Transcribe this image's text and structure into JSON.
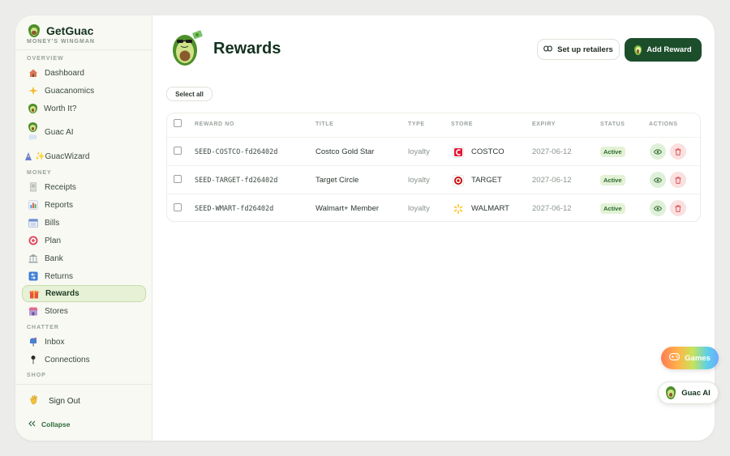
{
  "brand": {
    "name": "GetGuac",
    "tagline": "MONEY'S WINGMAN"
  },
  "sidebar": {
    "sections": {
      "overview": "OVERVIEW",
      "money": "MONEY",
      "chatter": "CHATTER",
      "shop": "SHOP"
    },
    "overview_items": [
      {
        "label": "Dashboard",
        "icon": "house-icon"
      },
      {
        "label": "Guacanomics",
        "icon": "sparkle-icon"
      },
      {
        "label": "Worth It?",
        "icon": "avocado-icon"
      },
      {
        "label": "Guac AI",
        "icon": "avocado-chat-icon"
      },
      {
        "label": "✨GuacWizard",
        "icon": "wizard-icon"
      }
    ],
    "money_items": [
      {
        "label": "Receipts",
        "icon": "receipt-icon"
      },
      {
        "label": "Reports",
        "icon": "bar-chart-icon"
      },
      {
        "label": "Bills",
        "icon": "calendar-icon"
      },
      {
        "label": "Plan",
        "icon": "target-icon"
      },
      {
        "label": "Bank",
        "icon": "bank-icon"
      },
      {
        "label": "Returns",
        "icon": "return-icon"
      },
      {
        "label": "Rewards",
        "icon": "gift-icon",
        "active": true
      },
      {
        "label": "Stores",
        "icon": "store-icon"
      }
    ],
    "chatter_items": [
      {
        "label": "Inbox",
        "icon": "mailbox-icon"
      },
      {
        "label": "Connections",
        "icon": "pin-icon"
      }
    ],
    "signout": "Sign Out",
    "collapse": "Collapse"
  },
  "header": {
    "title": "Rewards",
    "setup_label": "Set up retailers",
    "add_label": "Add Reward"
  },
  "toolbar": {
    "select_all": "Select all"
  },
  "table": {
    "columns": [
      "REWARD NO",
      "TITLE",
      "TYPE",
      "STORE",
      "EXPIRY",
      "STATUS",
      "ACTIONS"
    ],
    "rows": [
      {
        "reward_no": "SEED-COSTCO-fd26402d",
        "title": "Costco Gold Star",
        "type": "loyalty",
        "store": "COSTCO",
        "expiry": "2027-06-12",
        "status": "Active"
      },
      {
        "reward_no": "SEED-TARGET-fd26402d",
        "title": "Target Circle",
        "type": "loyalty",
        "store": "TARGET",
        "expiry": "2027-06-12",
        "status": "Active"
      },
      {
        "reward_no": "SEED-WMART-fd26402d",
        "title": "Walmart+ Member",
        "type": "loyalty",
        "store": "WALMART",
        "expiry": "2027-06-12",
        "status": "Active"
      }
    ]
  },
  "fabs": {
    "games": "Games",
    "guac_ai": "Guac AI"
  },
  "colors": {
    "primary": "#1d4e2c",
    "active_bg": "#e6f1d6",
    "status_active": "#2b6a2e",
    "costco_red": "#e31837",
    "target_red": "#cc0000",
    "walmart_yellow": "#ffc220"
  }
}
